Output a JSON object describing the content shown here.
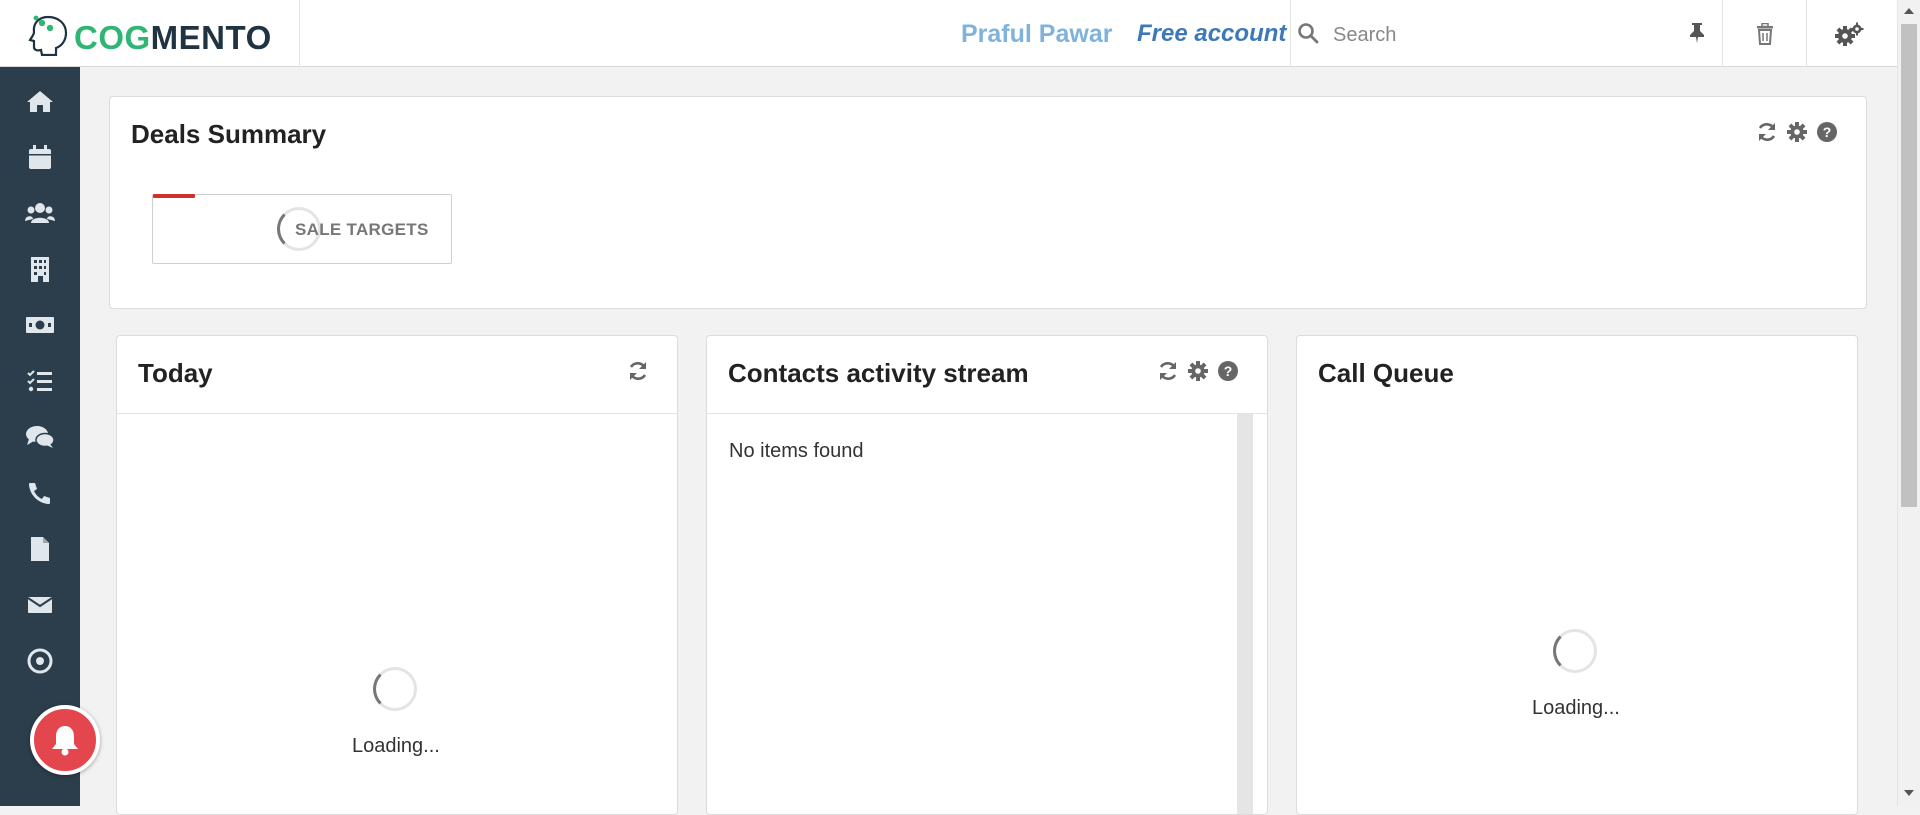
{
  "header": {
    "logo_cog": "COG",
    "logo_mento": "MENTO",
    "user_name": "Praful Pawar",
    "account_type": "Free account",
    "search_placeholder": "Search"
  },
  "sidebar": {
    "items": [
      {
        "icon": "home-icon"
      },
      {
        "icon": "calendar-icon"
      },
      {
        "icon": "contacts-icon"
      },
      {
        "icon": "companies-icon"
      },
      {
        "icon": "deals-icon"
      },
      {
        "icon": "tasks-icon"
      },
      {
        "icon": "cases-icon"
      },
      {
        "icon": "calls-icon"
      },
      {
        "icon": "documents-icon"
      },
      {
        "icon": "email-icon"
      },
      {
        "icon": "campaigns-icon"
      }
    ]
  },
  "deals_summary": {
    "title": "Deals Summary",
    "sale_targets_label": "SALE TARGETS"
  },
  "today": {
    "title": "Today",
    "loading_text": "Loading..."
  },
  "contacts_activity": {
    "title": "Contacts activity stream",
    "empty_text": "No items found"
  },
  "call_queue": {
    "title": "Call Queue",
    "loading_text": "Loading..."
  },
  "colors": {
    "sidebar_bg": "#2c3e4c",
    "logo_green": "#2fb574",
    "user_name": "#7fb3dc",
    "account": "#3d79b8",
    "notification_red": "#e4464d"
  }
}
